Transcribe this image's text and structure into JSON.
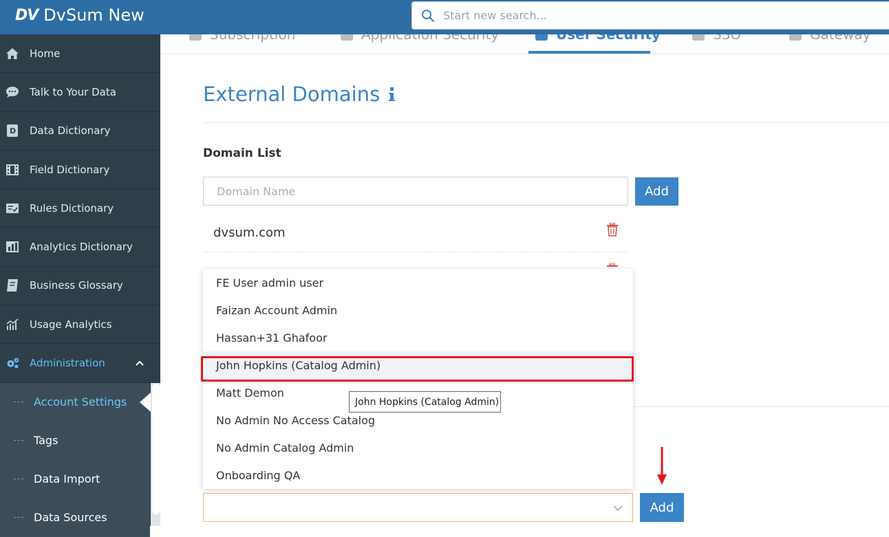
{
  "app": {
    "logo_mark": "DV",
    "title": "DvSum New",
    "brand_color": "#2e6da4",
    "accent_color": "#3a84c7"
  },
  "search": {
    "placeholder": "Start new search...",
    "icon": "search-icon"
  },
  "sidebar": {
    "items": [
      {
        "label": "Home",
        "icon": "home-icon"
      },
      {
        "label": "Talk to Your Data",
        "icon": "chat-icon"
      },
      {
        "label": "Data Dictionary",
        "icon": "dictionary-icon"
      },
      {
        "label": "Field Dictionary",
        "icon": "film-icon"
      },
      {
        "label": "Rules Dictionary",
        "icon": "checklist-icon"
      },
      {
        "label": "Analytics Dictionary",
        "icon": "bar-chart-icon"
      },
      {
        "label": "Business Glossary",
        "icon": "book-icon"
      },
      {
        "label": "Usage Analytics",
        "icon": "line-chart-icon"
      },
      {
        "label": "Administration",
        "icon": "gears-icon",
        "expanded": true
      }
    ],
    "submenu": [
      {
        "label": "Account Settings",
        "active": true
      },
      {
        "label": "Tags"
      },
      {
        "label": "Data Import"
      },
      {
        "label": "Data Sources"
      }
    ]
  },
  "tabs": [
    {
      "label": "Subscription"
    },
    {
      "label": "Application Security"
    },
    {
      "label": "User Security",
      "active": true
    },
    {
      "label": "SSO"
    },
    {
      "label": "Gateway"
    }
  ],
  "main": {
    "heading": "External Domains",
    "domain_list_label": "Domain List",
    "domain_input_placeholder": "Domain Name",
    "add_label": "Add",
    "domains": [
      "dvsum.com"
    ],
    "select_add_label": "Add"
  },
  "dropdown": {
    "options": [
      "FE User admin user",
      "Faizan Account Admin",
      "Hassan+31 Ghafoor",
      "John Hopkins (Catalog Admin)",
      "Matt Demon",
      "No Admin No Access Catalog",
      "No Admin Catalog Admin",
      "Onboarding QA"
    ],
    "highlighted": "John Hopkins (Catalog Admin)",
    "tooltip": "John Hopkins (Catalog Admin)"
  }
}
